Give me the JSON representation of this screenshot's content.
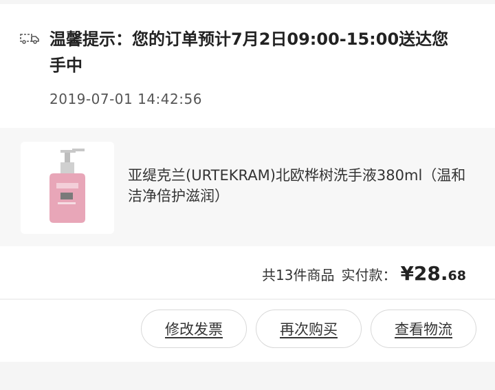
{
  "order": {
    "notice_text": "温馨提示：您的订单预计7月2日09:00-15:00送达您手中",
    "notice_icon": "delivery-truck-icon",
    "timestamp": "2019-07-01 14:42:56",
    "product": {
      "name": "亚缇克兰(URTEKRAM)北欧桦树洗手液380ml（温和洁净倍护滋润）",
      "image": "pink-hand-soap-pump-bottle"
    },
    "summary": {
      "count_text": "共13件商品",
      "paid_label": "实付款：",
      "price_int": "¥28.",
      "price_dec": "68"
    },
    "buttons": {
      "edit_invoice": "修改发票",
      "buy_again": "再次购买",
      "view_logistics": "查看物流"
    }
  }
}
